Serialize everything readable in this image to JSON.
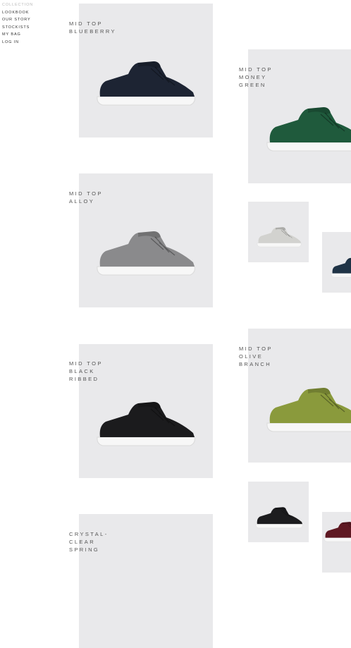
{
  "nav": {
    "items": [
      {
        "label": "COLLECTION",
        "active": true
      },
      {
        "label": "LOOKBOOK",
        "active": false
      },
      {
        "label": "OUR STORY",
        "active": false
      },
      {
        "label": "STOCKISTS",
        "active": false
      },
      {
        "label": "MY BAG",
        "active": false
      },
      {
        "label": "LOG IN",
        "active": false
      }
    ]
  },
  "products": [
    {
      "name": "MID TOP\nBLUEBERRY",
      "color": "#1d2433"
    },
    {
      "name": "MID TOP\nMONEY\nGREEN",
      "color": "#1f5a3c"
    },
    {
      "name": "MID TOP\nALLOY",
      "color": "#8a8a8c"
    },
    {
      "name": "",
      "color": "#d2d2cf"
    },
    {
      "name": "",
      "color": "#1f3346"
    },
    {
      "name": "MID TOP\nBLACK\nRIBBED",
      "color": "#1b1b1d"
    },
    {
      "name": "MID TOP\nOLIVE\nBRANCH",
      "color": "#8a9a3c"
    },
    {
      "name": "",
      "color": "#1c1c1e"
    },
    {
      "name": "",
      "color": "#5e1822"
    },
    {
      "name": "CRYSTAL-\nCLEAR\nSPRING",
      "color": "#dcdcdc"
    }
  ]
}
